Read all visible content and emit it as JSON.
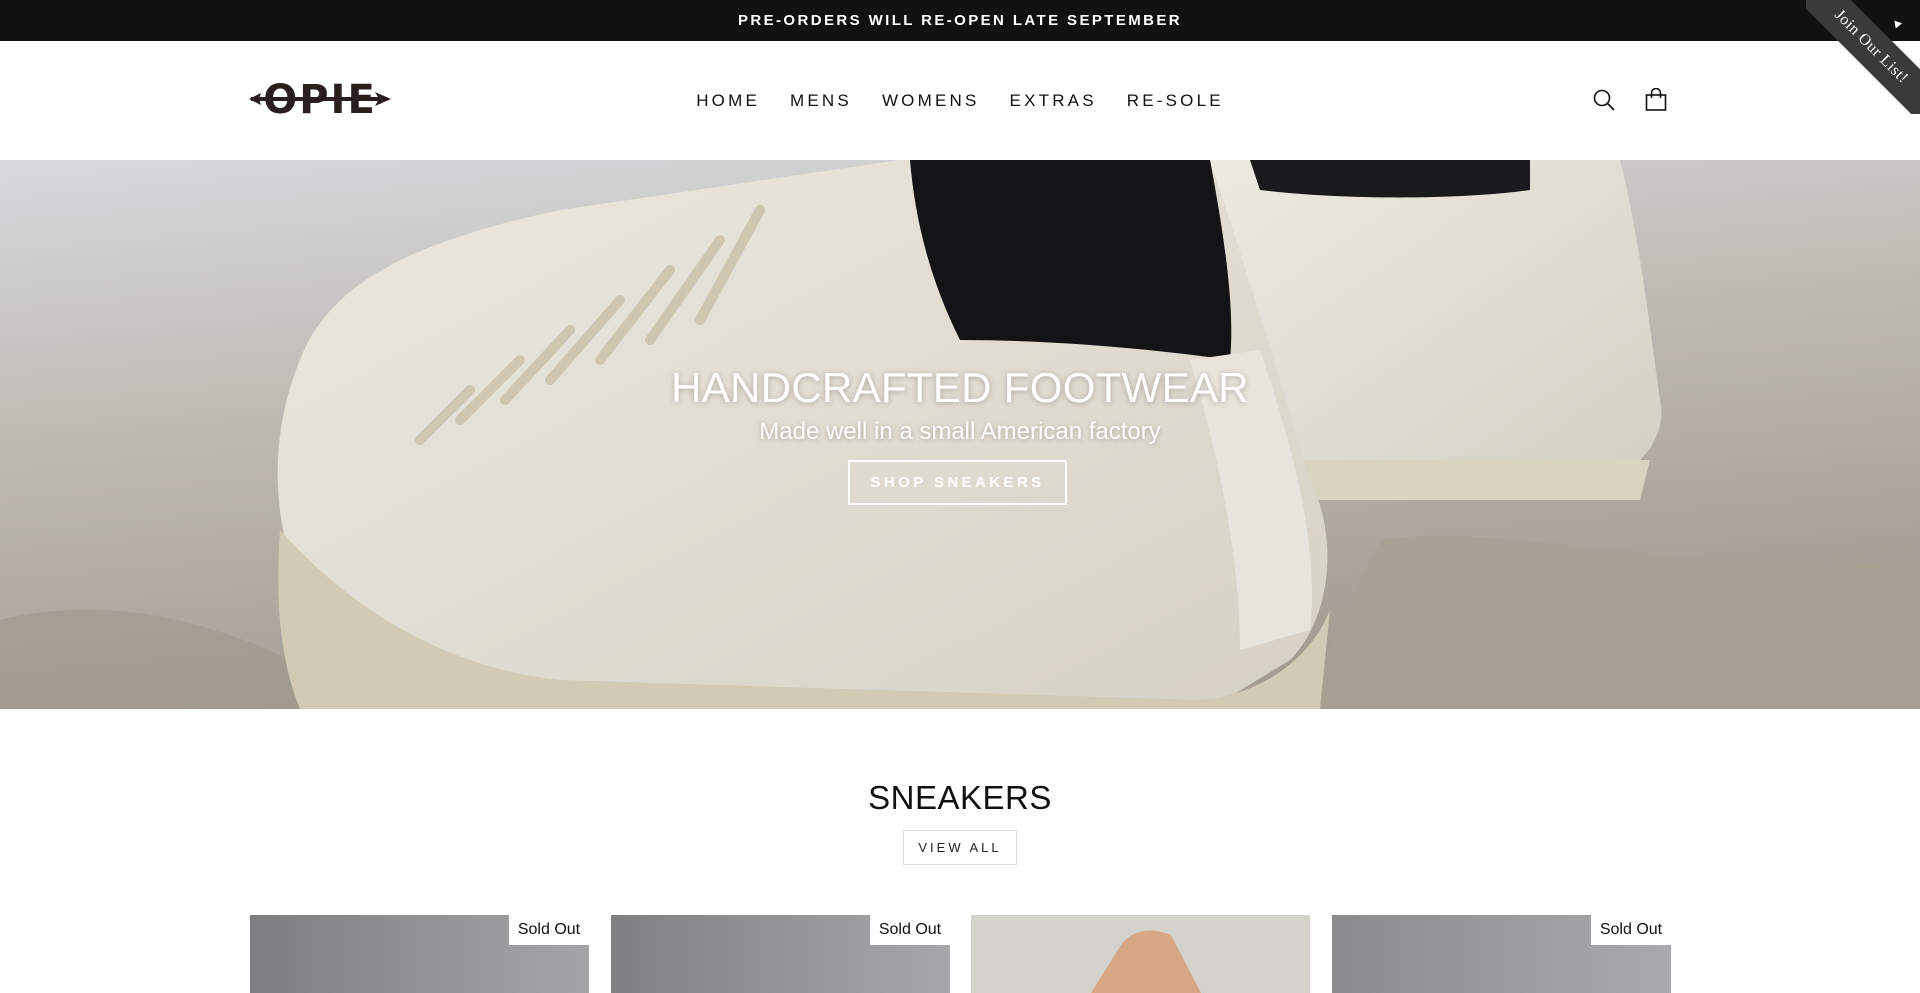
{
  "announcement": {
    "text": "PRE-ORDERS WILL RE-OPEN LATE SEPTEMBER"
  },
  "ribbon": {
    "text": "Join Our List!"
  },
  "header": {
    "logo_text": "OPIE",
    "nav": [
      {
        "label": "HOME"
      },
      {
        "label": "MENS"
      },
      {
        "label": "WOMENS"
      },
      {
        "label": "EXTRAS"
      },
      {
        "label": "RE-SOLE"
      }
    ],
    "icons": {
      "search": "search-icon",
      "cart": "cart-icon"
    }
  },
  "hero": {
    "title": "HANDCRAFTED FOOTWEAR",
    "subtitle": "Made well in a small American factory",
    "button": "SHOP SNEAKERS"
  },
  "sneakers": {
    "title": "SNEAKERS",
    "view_all": "VIEW ALL",
    "products": [
      {
        "badge": "Sold Out"
      },
      {
        "badge": "Sold Out"
      },
      {
        "badge": ""
      },
      {
        "badge": "Sold Out"
      }
    ]
  },
  "colors": {
    "announcement_bg": "#111111",
    "ribbon_bg": "#3a3a3a",
    "text": "#111111"
  }
}
